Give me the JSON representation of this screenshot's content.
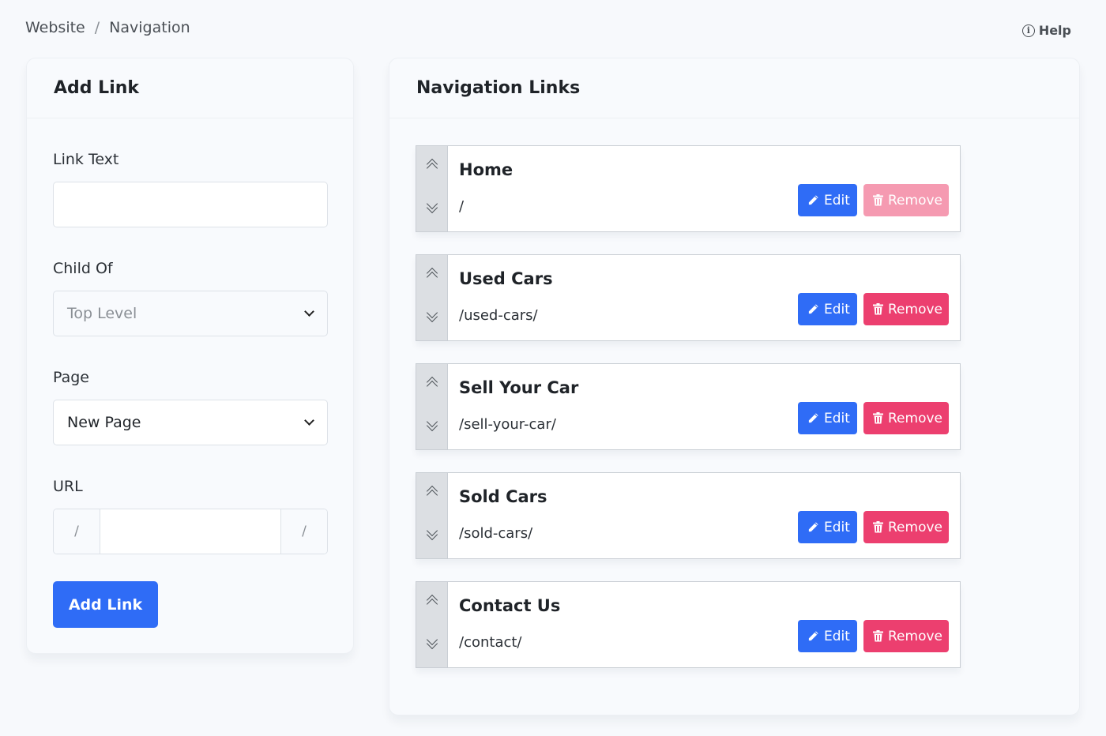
{
  "breadcrumb": {
    "root": "Website",
    "separator": "/",
    "current": "Navigation"
  },
  "help": {
    "icon": "info-icon",
    "icon_glyph": "i",
    "label": "Help"
  },
  "add_link": {
    "title": "Add Link",
    "link_text_label": "Link Text",
    "link_text_value": "",
    "child_of_label": "Child Of",
    "child_of_value": "Top Level",
    "page_label": "Page",
    "page_value": "New Page",
    "url_label": "URL",
    "url_prefix": "/",
    "url_value": "",
    "url_suffix": "/",
    "submit_label": "Add Link"
  },
  "nav_links": {
    "title": "Navigation Links",
    "edit_label": "Edit",
    "remove_label": "Remove",
    "items": [
      {
        "title": "Home",
        "url": "/",
        "remove_disabled": true
      },
      {
        "title": "Used Cars",
        "url": "/used-cars/",
        "remove_disabled": false
      },
      {
        "title": "Sell Your Car",
        "url": "/sell-your-car/",
        "remove_disabled": false
      },
      {
        "title": "Sold Cars",
        "url": "/sold-cars/",
        "remove_disabled": false
      },
      {
        "title": "Contact Us",
        "url": "/contact/",
        "remove_disabled": false
      }
    ]
  },
  "colors": {
    "primary": "#2f6cf6",
    "danger": "#ec3f6f",
    "danger_disabled": "#f59ab1",
    "background": "#f7f9fc"
  }
}
